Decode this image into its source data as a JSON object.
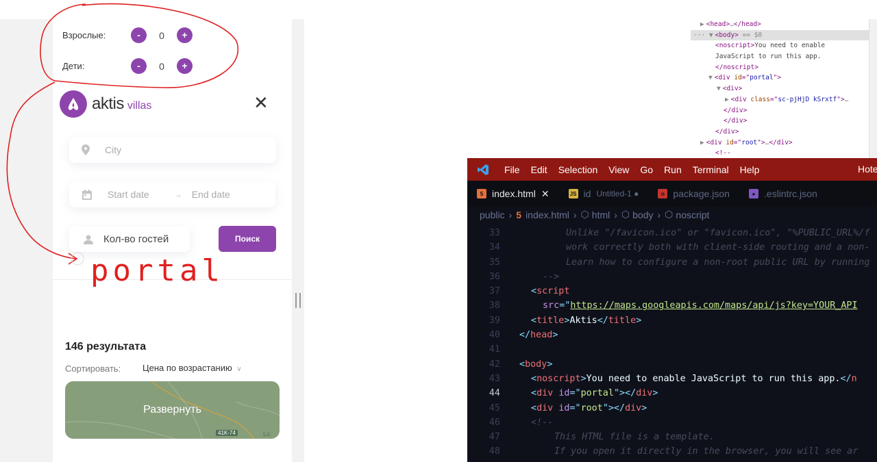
{
  "app": {
    "guests": [
      {
        "label": "Взрослые:",
        "count": "0",
        "minus": "-",
        "plus": "+"
      },
      {
        "label": "Дети:",
        "count": "0",
        "minus": "-",
        "plus": "+"
      }
    ],
    "logo": {
      "name": "aktis",
      "sub": "villas"
    },
    "close": "✕",
    "city_placeholder": "City",
    "start_date": "Start date",
    "arrow": "→",
    "end_date": "End date",
    "guests_field": "Кол-во гостей",
    "search_button": "Поиск",
    "results": "146 результата",
    "sort_label": "Сортировать:",
    "sort_value": "Цена по возрастанию",
    "sort_chevron": "∨",
    "map_button": "Развернуть",
    "map_road": "41K-74",
    "map_edge": "Lu",
    "brand_color": "#8e44ad"
  },
  "annotation": {
    "word": "portal",
    "color": "#e02020"
  },
  "devtools": {
    "lines": [
      {
        "indent": 14,
        "arrow": "▶",
        "html": [
          [
            "tag",
            "<head>"
          ],
          [
            "dim",
            "…"
          ],
          [
            "tag",
            "</head>"
          ]
        ]
      },
      {
        "indent": 4,
        "arrow": "··· ▼",
        "sel": true,
        "html": [
          [
            "tag",
            "<body>"
          ],
          [
            "dim",
            " == $0"
          ]
        ]
      },
      {
        "indent": 36,
        "arrow": "",
        "html": [
          [
            "tag",
            "<noscript>"
          ],
          [
            "text",
            "You need to enable"
          ]
        ]
      },
      {
        "indent": 36,
        "arrow": "",
        "html": [
          [
            "text",
            "JavaScript to run this app."
          ]
        ]
      },
      {
        "indent": 36,
        "arrow": "",
        "html": [
          [
            "tag",
            "</noscript>"
          ]
        ]
      },
      {
        "indent": 26,
        "arrow": "▼",
        "html": [
          [
            "tag",
            "<div "
          ],
          [
            "attr",
            "id"
          ],
          [
            "tag",
            "=\""
          ],
          [
            "aval",
            "portal"
          ],
          [
            "tag",
            "\">"
          ]
        ]
      },
      {
        "indent": 38,
        "arrow": "▼",
        "html": [
          [
            "tag",
            "<div>"
          ]
        ]
      },
      {
        "indent": 50,
        "arrow": "▶",
        "html": [
          [
            "tag",
            "<div "
          ],
          [
            "attr",
            "class"
          ],
          [
            "tag",
            "=\""
          ],
          [
            "aval",
            "sc-pjHjD kSrxtf"
          ],
          [
            "tag",
            "\">"
          ],
          [
            "dim",
            "…"
          ]
        ]
      },
      {
        "indent": 48,
        "arrow": "",
        "html": [
          [
            "tag",
            "</div>"
          ]
        ]
      },
      {
        "indent": 48,
        "arrow": "",
        "html": [
          [
            "tag",
            "</div>"
          ]
        ]
      },
      {
        "indent": 36,
        "arrow": "",
        "html": [
          [
            "tag",
            "</div>"
          ]
        ]
      },
      {
        "indent": 14,
        "arrow": "▶",
        "html": [
          [
            "tag",
            "<div "
          ],
          [
            "attr",
            "id"
          ],
          [
            "tag",
            "=\""
          ],
          [
            "aval",
            "root"
          ],
          [
            "tag",
            "\">"
          ],
          [
            "dim",
            "…"
          ],
          [
            "tag",
            "</div>"
          ]
        ]
      },
      {
        "indent": 36,
        "arrow": "",
        "html": [
          [
            "tag",
            "<!--"
          ]
        ]
      }
    ]
  },
  "vscode": {
    "menu": [
      "File",
      "Edit",
      "Selection",
      "View",
      "Go",
      "Run",
      "Terminal",
      "Help"
    ],
    "title_right": "Hote",
    "tabs": [
      {
        "label": "index.html",
        "extra": "✕",
        "icon": "5",
        "icon_color": "#e5703c",
        "active": true
      },
      {
        "label": "id",
        "extra": "Untitled-1 ●",
        "icon": "JS",
        "icon_color": "#d7b341",
        "active": false
      },
      {
        "label": "package.json",
        "extra": "",
        "icon": "n",
        "icon_color": "#c3352f",
        "active": false
      },
      {
        "label": ".eslintrc.json",
        "extra": "",
        "icon": "●",
        "icon_color": "#7e57c2",
        "active": false
      }
    ],
    "breadcrumbs": [
      "public",
      "index.html",
      "html",
      "body",
      "noscript"
    ],
    "lines": [
      {
        "n": "33",
        "indent": 4,
        "parts": [
          [
            "c-comment",
            "Unlike \"/favicon.ico\" or \"favicon.ico\", \"%PUBLIC_URL%/f"
          ]
        ]
      },
      {
        "n": "34",
        "indent": 4,
        "parts": [
          [
            "c-comment",
            "work correctly both with client-side routing and a non-"
          ]
        ]
      },
      {
        "n": "35",
        "indent": 4,
        "parts": [
          [
            "c-comment",
            "Learn how to configure a non-root public URL by running"
          ]
        ]
      },
      {
        "n": "36",
        "indent": 2,
        "parts": [
          [
            "c-comment",
            "-->"
          ]
        ]
      },
      {
        "n": "37",
        "indent": 1,
        "parts": [
          [
            "c-punc",
            "<"
          ],
          [
            "c-tag",
            "script"
          ]
        ]
      },
      {
        "n": "38",
        "indent": 2,
        "parts": [
          [
            "c-attr",
            "src"
          ],
          [
            "c-punc",
            "=\""
          ],
          [
            "c-link",
            "https://maps.googleapis.com/maps/api/js?key=YOUR_API"
          ]
        ]
      },
      {
        "n": "39",
        "indent": 1,
        "parts": [
          [
            "c-punc",
            "<"
          ],
          [
            "c-tag",
            "title"
          ],
          [
            "c-punc",
            ">"
          ],
          [
            "c-text",
            "Aktis"
          ],
          [
            "c-punc",
            "</"
          ],
          [
            "c-tag",
            "title"
          ],
          [
            "c-punc",
            ">"
          ]
        ]
      },
      {
        "n": "40",
        "indent": 0,
        "parts": [
          [
            "c-punc",
            "</"
          ],
          [
            "c-tag",
            "head"
          ],
          [
            "c-punc",
            ">"
          ]
        ]
      },
      {
        "n": "41",
        "indent": 0,
        "parts": []
      },
      {
        "n": "42",
        "indent": 0,
        "parts": [
          [
            "c-punc",
            "<"
          ],
          [
            "c-tag",
            "body"
          ],
          [
            "c-punc",
            ">"
          ]
        ]
      },
      {
        "n": "43",
        "indent": 1,
        "parts": [
          [
            "c-punc",
            "<"
          ],
          [
            "c-tag",
            "noscript"
          ],
          [
            "c-punc",
            ">"
          ],
          [
            "c-text",
            "You need to enable JavaScript to run this app."
          ],
          [
            "c-punc",
            "</"
          ],
          [
            "c-tag",
            "n"
          ]
        ]
      },
      {
        "n": "44",
        "indent": 1,
        "cur": true,
        "parts": [
          [
            "c-punc",
            "<"
          ],
          [
            "c-tag",
            "div"
          ],
          [
            "c-text",
            " "
          ],
          [
            "c-attr",
            "id"
          ],
          [
            "c-punc",
            "=\""
          ],
          [
            "c-str",
            "portal"
          ],
          [
            "c-punc",
            "\"></"
          ],
          [
            "c-tag",
            "div"
          ],
          [
            "c-punc",
            ">"
          ]
        ]
      },
      {
        "n": "45",
        "indent": 1,
        "parts": [
          [
            "c-punc",
            "<"
          ],
          [
            "c-tag",
            "div"
          ],
          [
            "c-text",
            " "
          ],
          [
            "c-attr",
            "id"
          ],
          [
            "c-punc",
            "=\""
          ],
          [
            "c-str",
            "root"
          ],
          [
            "c-punc",
            "\"></"
          ],
          [
            "c-tag",
            "div"
          ],
          [
            "c-punc",
            ">"
          ]
        ]
      },
      {
        "n": "46",
        "indent": 1,
        "parts": [
          [
            "c-comment",
            "<!--"
          ]
        ]
      },
      {
        "n": "47",
        "indent": 3,
        "parts": [
          [
            "c-comment",
            "This HTML file is a template."
          ]
        ]
      },
      {
        "n": "48",
        "indent": 3,
        "parts": [
          [
            "c-comment",
            "If you open it directly in the browser, you will see ar"
          ]
        ]
      }
    ]
  }
}
